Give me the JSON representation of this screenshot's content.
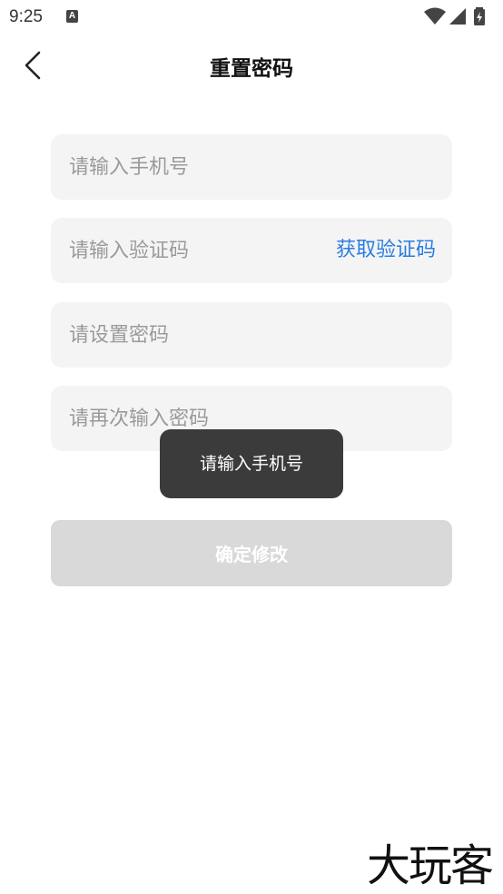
{
  "status_bar": {
    "time": "9:25",
    "notification_icon": "A"
  },
  "header": {
    "title": "重置密码"
  },
  "form": {
    "phone_placeholder": "请输入手机号",
    "code_placeholder": "请输入验证码",
    "get_code_label": "获取验证码",
    "password_placeholder": "请设置密码",
    "confirm_placeholder": "请再次输入密码",
    "submit_label": "确定修改"
  },
  "toast": {
    "message": "请输入手机号"
  },
  "watermark": {
    "text": "大玩客"
  },
  "colors": {
    "accent": "#2a7de1",
    "field_bg": "#f4f4f4",
    "button_disabled": "#d9d9d9",
    "toast_bg": "#303030"
  },
  "icons": [
    "chevron-left-icon",
    "wifi-icon",
    "signal-icon",
    "battery-icon"
  ]
}
